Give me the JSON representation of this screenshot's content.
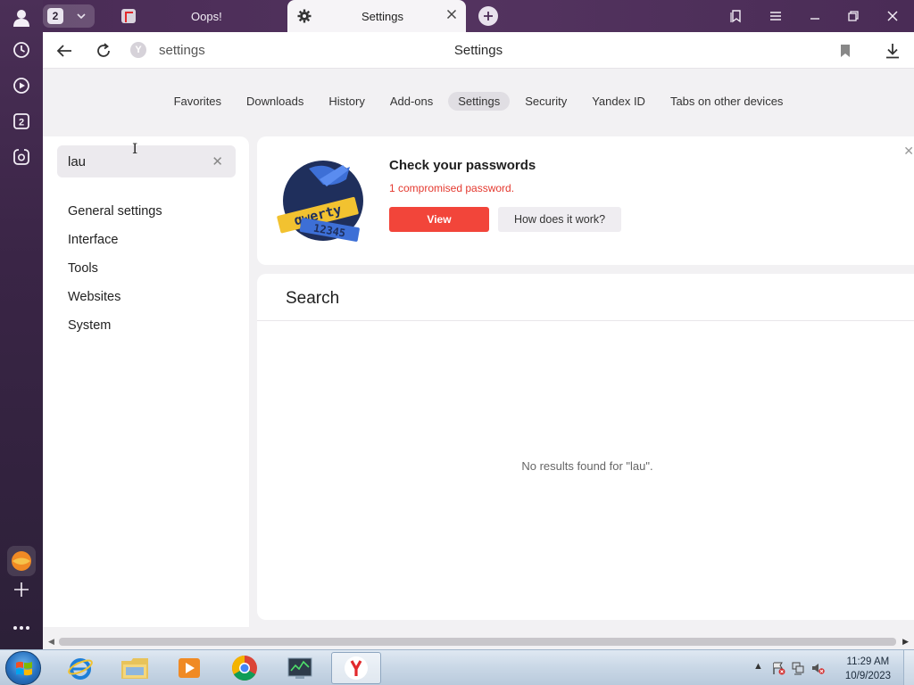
{
  "browser": {
    "tab_count": "2",
    "tabs": [
      {
        "label": "Oops!"
      },
      {
        "label": "Settings"
      }
    ],
    "address": {
      "url_text": "settings",
      "page_title": "Settings"
    }
  },
  "settings_nav": {
    "tabs": [
      {
        "label": "Favorites"
      },
      {
        "label": "Downloads"
      },
      {
        "label": "History"
      },
      {
        "label": "Add-ons"
      },
      {
        "label": "Settings",
        "active": true
      },
      {
        "label": "Security"
      },
      {
        "label": "Yandex ID"
      },
      {
        "label": "Tabs on other devices"
      }
    ]
  },
  "sidebar": {
    "search_value": "lau",
    "menu": [
      {
        "label": "General settings"
      },
      {
        "label": "Interface"
      },
      {
        "label": "Tools"
      },
      {
        "label": "Websites"
      },
      {
        "label": "System"
      }
    ]
  },
  "password_card": {
    "title": "Check your passwords",
    "subtitle": "1 compromised password.",
    "view_label": "View",
    "how_label": "How does it work?",
    "sticker_words": [
      "qwerty",
      "12345"
    ]
  },
  "search_panel": {
    "title": "Search",
    "no_results": "No results found for \"lau\"."
  },
  "taskbar": {
    "time": "11:29 AM",
    "date": "10/9/2023"
  },
  "colors": {
    "accent_red": "#f2453a",
    "browser_purple": "#4a2c56"
  }
}
